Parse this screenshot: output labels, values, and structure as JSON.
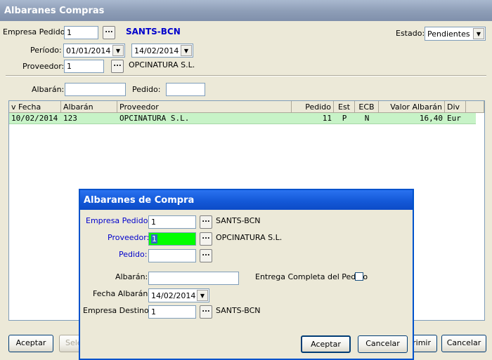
{
  "window": {
    "title": "Albaranes Compras"
  },
  "filters": {
    "empresa_label": "Empresa Pedido:",
    "empresa_value": "1",
    "empresa_name": "SANTS-BCN",
    "estado_label": "Estado:",
    "estado_value": "Pendientes",
    "periodo_label": "Período:",
    "periodo_from": "01/01/2014",
    "periodo_to": "14/02/2014",
    "proveedor_label": "Proveedor:",
    "proveedor_value": "1",
    "proveedor_name": "OPCINATURA S.L.",
    "albaran_label": "Albarán:",
    "albaran_value": "",
    "pedido_label": "Pedido:",
    "pedido_value": "",
    "dots": "..."
  },
  "grid": {
    "columns": [
      "v Fecha",
      "Albarán",
      "Proveedor",
      "Pedido",
      "Est",
      "ECB",
      "Valor Albarán",
      "Div"
    ],
    "rows": [
      [
        "10/02/2014",
        "123",
        "OPCINATURA S.L.",
        "11",
        "P",
        "N",
        "16,40",
        "Eur"
      ]
    ]
  },
  "footer": {
    "aceptar": "Aceptar",
    "seleccionar": "Sele",
    "imprimir": "rimir",
    "cancelar": "Cancelar"
  },
  "dialog": {
    "title": "Albaranes de Compra",
    "empresa_label": "Empresa Pedido:",
    "empresa_value": "1",
    "empresa_name": "SANTS-BCN",
    "proveedor_label": "Proveedor:",
    "proveedor_value": "1",
    "proveedor_name": "OPCINATURA S.L.",
    "pedido_label": "Pedido:",
    "pedido_value": "",
    "albaran_label": "Albarán:",
    "albaran_value": "",
    "entrega_label": "Entrega Completa del Pedido",
    "fecha_label": "Fecha Albarán:",
    "fecha_value": "14/02/2014",
    "destino_label": "Empresa Destino:",
    "destino_value": "1",
    "destino_name": "SANTS-BCN",
    "aceptar": "Aceptar",
    "cancelar": "Cancelar",
    "dots": "..."
  },
  "colors": {
    "window_bg": "#ece9d8",
    "row_highlight": "#c7f3c7",
    "focus_field": "#00ff00",
    "label_blue": "#0000cc",
    "dialog_title": "#1459d8"
  }
}
